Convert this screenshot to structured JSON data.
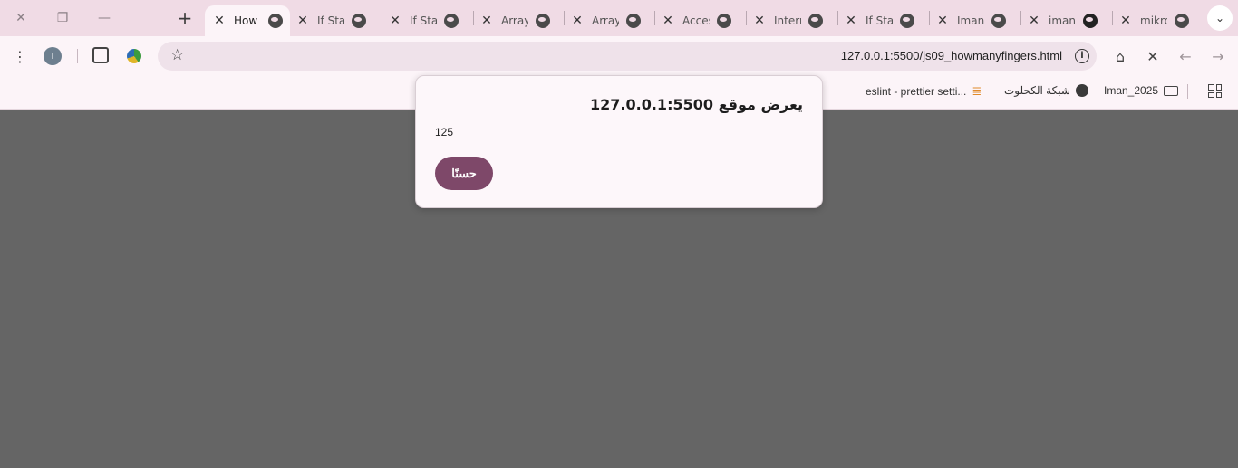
{
  "window": {
    "close_glyph": "✕",
    "restore_glyph": "❐",
    "minimize_glyph": "—"
  },
  "tabs": [
    {
      "label": "How ",
      "active": true
    },
    {
      "label": "If Stat",
      "active": false
    },
    {
      "label": "If Stat",
      "active": false
    },
    {
      "label": "Array",
      "active": false
    },
    {
      "label": "Array",
      "active": false
    },
    {
      "label": "Acces",
      "active": false
    },
    {
      "label": "Intern",
      "active": false
    },
    {
      "label": "If Stat",
      "active": false
    },
    {
      "label": "Iman",
      "active": false
    },
    {
      "label": "iman",
      "active": false
    },
    {
      "label": "mikro",
      "active": false
    }
  ],
  "toolbar": {
    "profile_initial": "I",
    "url": "127.0.0.1:5500/js09_howmanyfingers.html"
  },
  "bookmarks": [
    {
      "label": "eslint - prettier setti...",
      "icon": "stackoverflow-icon"
    },
    {
      "label": "شبكة الكحلوت",
      "icon": "globe-icon"
    },
    {
      "label": "Iman_2025",
      "icon": "folder-icon"
    }
  ],
  "dialog": {
    "title": "يعرض موقع 127.0.0.1:5500",
    "message": "125",
    "ok_label": "حسنًا"
  },
  "colors": {
    "tabstrip": "#f0dbe5",
    "toolbar": "#fcf4f8",
    "content_bg": "#656565",
    "accent_button": "#7e4869"
  }
}
